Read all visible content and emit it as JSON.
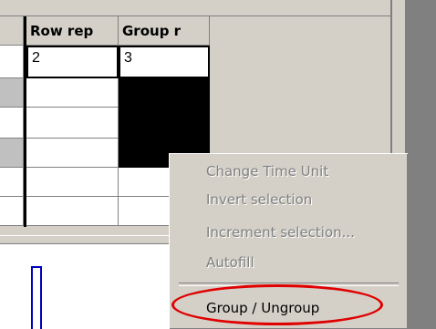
{
  "grid": {
    "columns": [
      {
        "label": ""
      },
      {
        "label": "Row rep"
      },
      {
        "label": "Group r"
      }
    ],
    "rows": [
      {
        "row_rep": "2",
        "group_r": "3"
      },
      {
        "row_rep": "",
        "group_r": ""
      },
      {
        "row_rep": "",
        "group_r": ""
      },
      {
        "row_rep": "",
        "group_r": ""
      },
      {
        "row_rep": "",
        "group_r": ""
      },
      {
        "row_rep": "",
        "group_r": ""
      }
    ]
  },
  "context_menu": {
    "items": [
      {
        "label": "Change Time Unit",
        "enabled": false
      },
      {
        "label": "Invert selection",
        "enabled": false
      },
      {
        "label": "Increment selection...",
        "enabled": false
      },
      {
        "label": "Autofill",
        "enabled": false
      },
      {
        "label": "Group / Ungroup",
        "enabled": true
      }
    ]
  },
  "colors": {
    "annotation_circle": "#e00000",
    "selection_fill": "#000000",
    "marker": "#0000c0"
  }
}
